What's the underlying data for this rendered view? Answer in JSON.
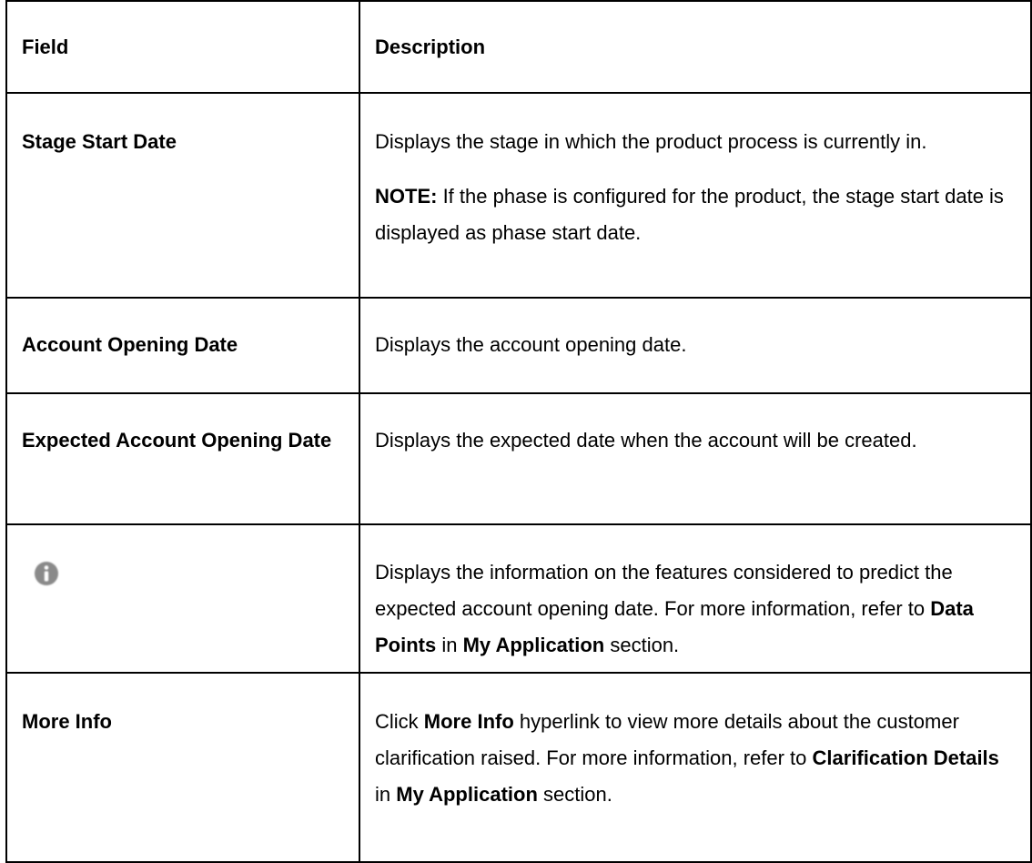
{
  "headers": {
    "field": "Field",
    "description": "Description"
  },
  "rows": [
    {
      "field": "Stage Start Date",
      "desc_p1": "Displays the stage in which the product process is currently in.",
      "note_label": "NOTE:",
      "note_text": " If the phase is configured for the product, the stage start date is displayed as phase start date."
    },
    {
      "field": "Account Opening Date",
      "desc_p1": "Displays the account opening date."
    },
    {
      "field": "Expected Account Opening Date",
      "desc_p1": "Displays the expected date when the account will be created."
    },
    {
      "field_icon": "info-icon",
      "desc_pre": "Displays the information on the features considered to predict the expected account opening date. For more information, refer to ",
      "desc_b1": "Data Points",
      "desc_mid": " in ",
      "desc_b2": "My Application",
      "desc_post": " section."
    },
    {
      "field": "More Info",
      "desc_a": "Click ",
      "desc_b0": "More Info",
      "desc_pre": " hyperlink to view more details about the customer clarification raised. For more information, refer to ",
      "desc_b1": "Clarification Details",
      "desc_mid": " in ",
      "desc_b2": "My Application",
      "desc_post": " section."
    }
  ],
  "colors": {
    "border": "#000000",
    "icon_fill": "#8a8a8a"
  }
}
